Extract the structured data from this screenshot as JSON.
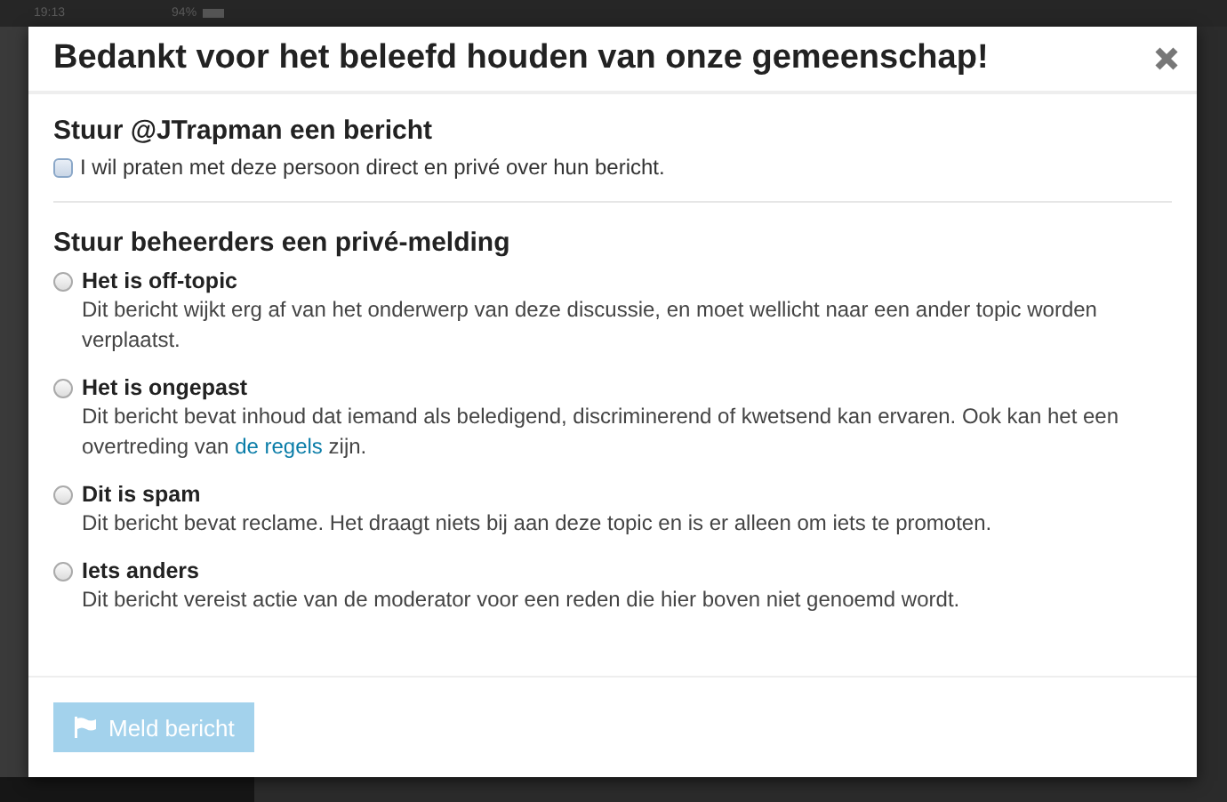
{
  "status_bar": {
    "time": "19:13",
    "battery": "94%"
  },
  "modal": {
    "title": "Bedankt voor het beleefd houden van onze gemeenschap!",
    "message_section": {
      "heading": "Stuur @JTrapman een bericht",
      "checkbox": {
        "label": "I wil praten met deze persoon direct en privé over hun bericht.",
        "checked": false
      }
    },
    "notify_section": {
      "heading": "Stuur beheerders een privé-melding",
      "options": [
        {
          "title": "Het is off-topic",
          "description": "Dit bericht wijkt erg af van het onderwerp van deze discussie, en moet wellicht naar een ander topic worden verplaatst.",
          "selected": false
        },
        {
          "title": "Het is ongepast",
          "description": "Dit bericht bevat inhoud dat iemand als beledigend, discriminerend of kwetsend kan ervaren. Ook kan het een overtreding van ",
          "link": "de regels",
          "description_end": " zijn.",
          "selected": false
        },
        {
          "title": "Dit is spam",
          "description": "Dit bericht bevat reclame. Het draagt niets bij aan deze topic en is er alleen om iets te promoten.",
          "selected": false
        },
        {
          "title": "Iets anders",
          "description": "Dit bericht vereist actie van de moderator voor een reden die hier boven niet genoemd wordt.",
          "selected": false
        }
      ]
    },
    "submit_button": {
      "label": "Meld bericht",
      "disabled": true
    }
  }
}
